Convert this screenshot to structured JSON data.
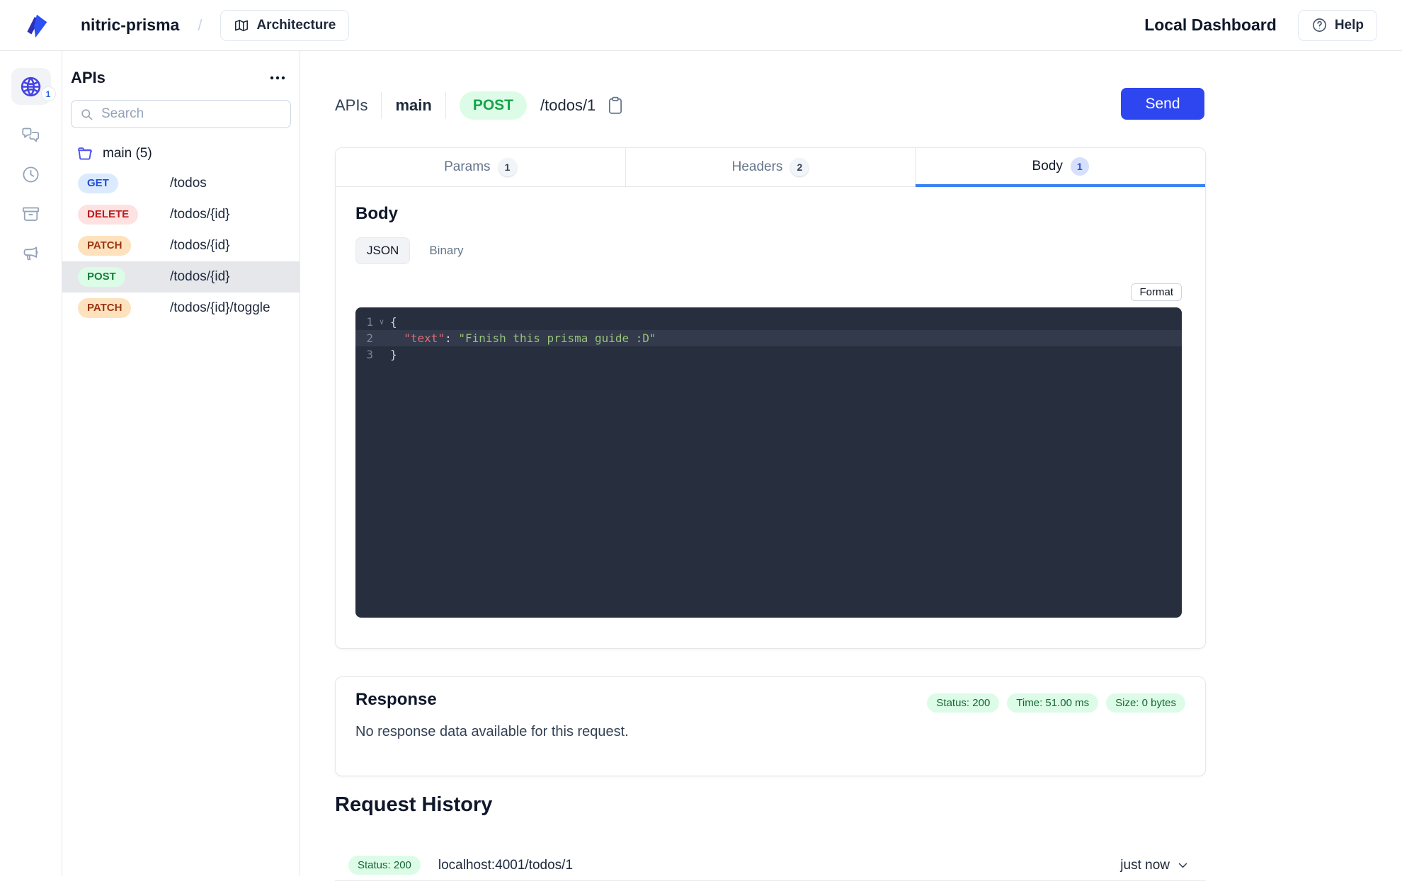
{
  "colors": {
    "accent_blue": "#2e46f0",
    "tab_active_blue": "#3b82f6",
    "globe_icon_blue": "#4443e2",
    "get_badge_text": "#1d4ed8",
    "delete_badge_text": "#b91c1c",
    "patch_badge_text": "#9a3412",
    "post_badge_text": "#15803d",
    "status_green_bg": "#dcfce7",
    "status_green_text": "#166534",
    "editor_bg": "#272e3d",
    "editor_key_color": "#e06c75",
    "editor_string_color": "#98c379"
  },
  "header": {
    "project_name": "nitric-prisma",
    "separator": "/",
    "architecture_label": "Architecture",
    "dashboard_title": "Local Dashboard",
    "help_label": "Help"
  },
  "rail": {
    "apis_badge_count": "1"
  },
  "sidebar": {
    "title": "APIs",
    "search_placeholder": "Search",
    "folder_label": "main (5)",
    "endpoints": [
      {
        "method": "GET",
        "path": "/todos",
        "selected": false
      },
      {
        "method": "DELETE",
        "path": "/todos/{id}",
        "selected": false
      },
      {
        "method": "PATCH",
        "path": "/todos/{id}",
        "selected": false
      },
      {
        "method": "POST",
        "path": "/todos/{id}",
        "selected": true
      },
      {
        "method": "PATCH",
        "path": "/todos/{id}/toggle",
        "selected": false
      }
    ]
  },
  "request_bar": {
    "breadcrumb_root": "APIs",
    "breadcrumb_api": "main",
    "method": "POST",
    "path": "/todos/1",
    "send_label": "Send"
  },
  "tabs": [
    {
      "label": "Params",
      "count": "1",
      "active": false
    },
    {
      "label": "Headers",
      "count": "2",
      "active": false
    },
    {
      "label": "Body",
      "count": "1",
      "active": true
    }
  ],
  "body_panel": {
    "title": "Body",
    "mode_json": "JSON",
    "mode_binary": "Binary",
    "active_mode": "JSON",
    "format_label": "Format",
    "editor": {
      "line_numbers": [
        "1",
        "2",
        "3"
      ],
      "fold_marker": "∨",
      "line1_code": "{",
      "line2_indent": "  ",
      "line2_key": "\"text\"",
      "line2_separator": ": ",
      "line2_value": "\"Finish this prisma guide :D\"",
      "line3_code": "}"
    }
  },
  "response_panel": {
    "title": "Response",
    "status_badge": "Status: 200",
    "time_badge": "Time: 51.00 ms",
    "size_badge": "Size: 0 bytes",
    "empty_message": "No response data available for this request."
  },
  "history": {
    "title": "Request History",
    "rows": [
      {
        "status": "Status: 200",
        "url": "localhost:4001/todos/1",
        "time": "just now"
      }
    ]
  }
}
